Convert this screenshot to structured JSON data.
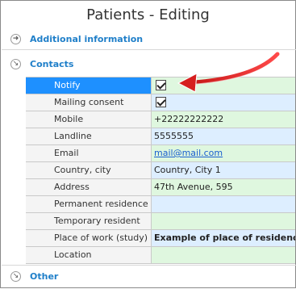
{
  "window": {
    "title": "Patients - Editing"
  },
  "groups": {
    "additional": {
      "label": "Additional information",
      "icon": "expand-circle-icon"
    },
    "contacts": {
      "label": "Contacts",
      "icon": "collapse-circle-icon"
    },
    "other": {
      "label": "Other",
      "icon": "collapse-circle-icon"
    }
  },
  "contacts": {
    "rows": [
      {
        "label": "Notify",
        "checked": true
      },
      {
        "label": "Mailing consent",
        "checked": true
      },
      {
        "label": "Mobile",
        "value": "+22222222222"
      },
      {
        "label": "Landline",
        "value": "5555555"
      },
      {
        "label": "Email",
        "value": "mail@mail.com"
      },
      {
        "label": "Country, city",
        "value": "Country, City 1"
      },
      {
        "label": "Address",
        "value": "47th Avenue, 595"
      },
      {
        "label": "Permanent residence",
        "value": ""
      },
      {
        "label": "Temporary resident",
        "value": ""
      },
      {
        "label": "Place of work (study)",
        "value": "Example of place of residence"
      },
      {
        "label": "Location",
        "value": ""
      }
    ]
  },
  "colors": {
    "selection": "#1e90ff",
    "group_label": "#1f7fc9",
    "value_blue": "#ddeeff",
    "value_green": "#dff7df",
    "annotation_arrow": "#e02020"
  }
}
